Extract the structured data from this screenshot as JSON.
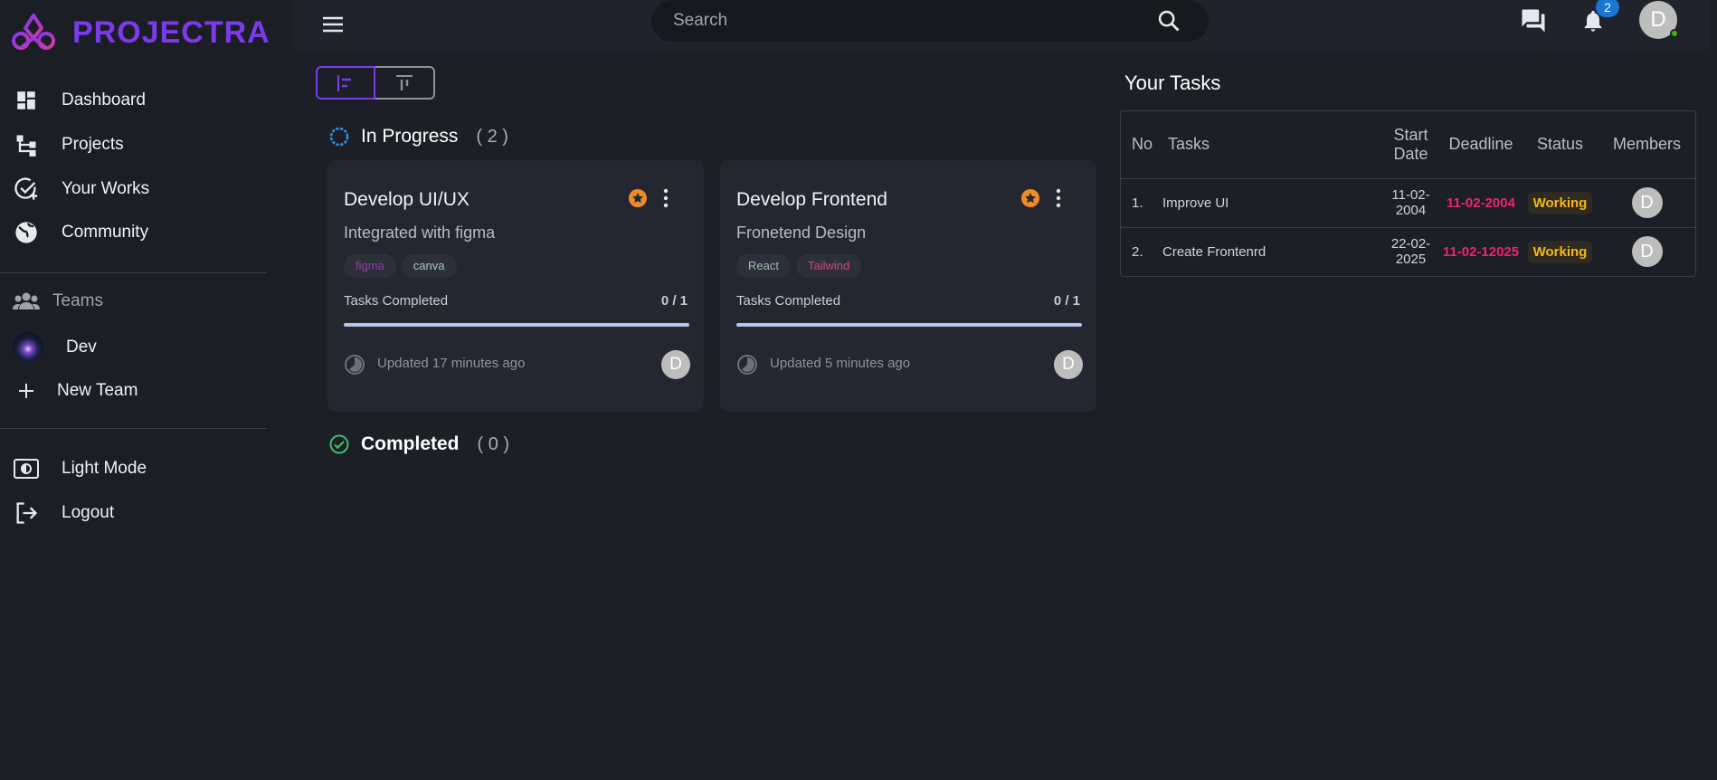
{
  "app": {
    "name": "PROJECTRA",
    "brand_color": "#7c3aed"
  },
  "sidebar": {
    "items": [
      {
        "label": "Dashboard",
        "icon": "dashboard-icon"
      },
      {
        "label": "Projects",
        "icon": "projects-icon"
      },
      {
        "label": "Your Works",
        "icon": "your-works-icon"
      },
      {
        "label": "Community",
        "icon": "globe-icon"
      }
    ],
    "teams_label": "Teams",
    "teams": [
      {
        "label": "Dev"
      }
    ],
    "new_team_label": "New Team",
    "light_mode_label": "Light Mode",
    "logout_label": "Logout"
  },
  "topbar": {
    "search_placeholder": "Search",
    "notification_count": "2",
    "user_initial": "D",
    "online_color": "#44b700"
  },
  "board": {
    "in_progress": {
      "title": "In Progress",
      "count": "( 2 )",
      "cards": [
        {
          "title": "Develop UI/UX",
          "description": "Integrated with figma",
          "tags": [
            {
              "label": "figma",
              "color": "#8a3fa3"
            },
            {
              "label": "canva",
              "color": "#a9c4d6"
            }
          ],
          "tasks_label": "Tasks Completed",
          "tasks_value": "0 / 1",
          "progress": 1,
          "updated": "Updated 17 minutes ago",
          "avatar": "D"
        },
        {
          "title": "Develop Frontend",
          "description": "Fronetend Design",
          "tags": [
            {
              "label": "React",
              "color": "#9fbfa8"
            },
            {
              "label": "Tailwind",
              "color": "#d0487e"
            }
          ],
          "tasks_label": "Tasks Completed",
          "tasks_value": "0 / 1",
          "progress": 1,
          "updated": "Updated 5 minutes ago",
          "avatar": "D"
        }
      ]
    },
    "completed": {
      "title": "Completed",
      "count": "( 0 )"
    }
  },
  "your_tasks": {
    "title": "Your Tasks",
    "headers": {
      "no": "No",
      "tasks": "Tasks",
      "start_date": "Start Date",
      "deadline": "Deadline",
      "status": "Status",
      "members": "Members"
    },
    "rows": [
      {
        "no": "1.",
        "task": "Improve UI",
        "start": "11-02-2004",
        "deadline": "11-02-2004",
        "status": "Working",
        "member": "D"
      },
      {
        "no": "2.",
        "task": "Create Frontenrd",
        "start": "22-02-2025",
        "deadline": "11-02-12025",
        "status": "Working",
        "member": "D"
      }
    ]
  }
}
